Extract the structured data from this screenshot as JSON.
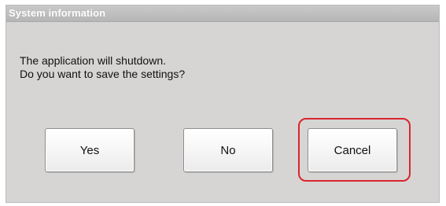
{
  "dialog": {
    "title": "System information",
    "message_lines": [
      "The application will shutdown.",
      "Do you want to save the settings?"
    ],
    "buttons": {
      "yes_label": "Yes",
      "no_label": "No",
      "cancel_label": "Cancel"
    }
  },
  "annotation": {
    "highlight_color": "#d9262c"
  }
}
